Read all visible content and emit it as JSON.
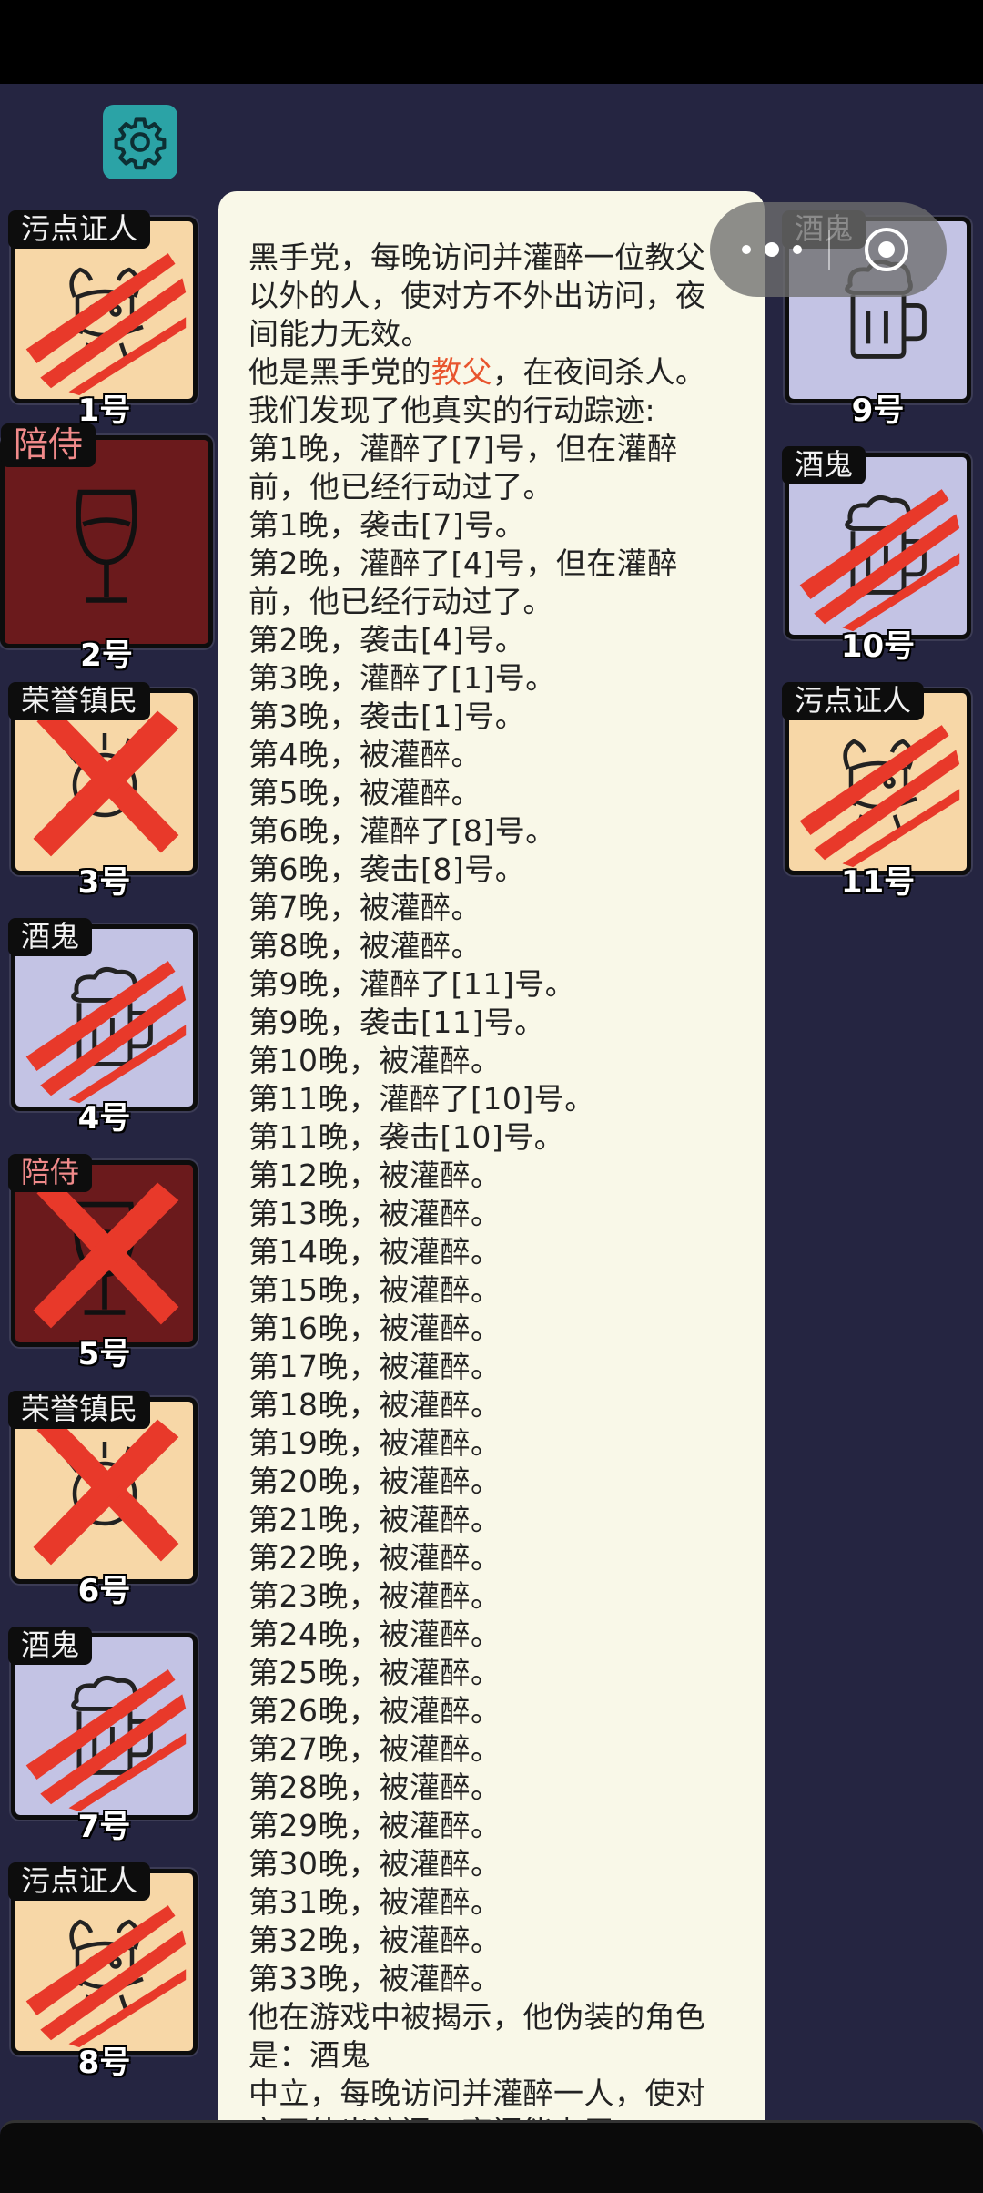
{
  "players": [
    {
      "role": "污点证人",
      "number": "1号",
      "theme": "witness",
      "mark": "claw"
    },
    {
      "role": "陪侍",
      "number": "2号",
      "theme": "servant",
      "mark": "none"
    },
    {
      "role": "荣誉镇民",
      "number": "3号",
      "theme": "citizen",
      "mark": "cross"
    },
    {
      "role": "酒鬼",
      "number": "4号",
      "theme": "drunk",
      "mark": "claw"
    },
    {
      "role": "陪侍",
      "number": "5号",
      "theme": "servant",
      "mark": "cross"
    },
    {
      "role": "荣誉镇民",
      "number": "6号",
      "theme": "citizen",
      "mark": "cross"
    },
    {
      "role": "酒鬼",
      "number": "7号",
      "theme": "drunk",
      "mark": "claw"
    },
    {
      "role": "污点证人",
      "number": "8号",
      "theme": "witness",
      "mark": "claw"
    },
    {
      "role": "酒鬼",
      "number": "9号",
      "theme": "drunk",
      "mark": "none"
    },
    {
      "role": "酒鬼",
      "number": "10号",
      "theme": "drunk",
      "mark": "claw"
    },
    {
      "role": "污点证人",
      "number": "11号",
      "theme": "witness",
      "mark": "claw"
    }
  ],
  "log": {
    "intro": "黑手党，每晚访问并灌醉一位教父以外的人，使对方不外出访问，夜间能力无效。",
    "identity_prefix": "他是黑手党的",
    "identity_highlight": "教父",
    "identity_suffix": "，在夜间杀人。",
    "trace_header": "我们发现了他真实的行动踪迹:",
    "entries": [
      "第1晚，灌醉了[7]号，但在灌醉前，他已经行动过了。",
      "第1晚，袭击[7]号。",
      "第2晚，灌醉了[4]号，但在灌醉前，他已经行动过了。",
      "第2晚，袭击[4]号。",
      "第3晚，灌醉了[1]号。",
      "第3晚，袭击[1]号。",
      "第4晚，被灌醉。",
      "第5晚，被灌醉。",
      "第6晚，灌醉了[8]号。",
      "第6晚，袭击[8]号。",
      "第7晚，被灌醉。",
      "第8晚，被灌醉。",
      "第9晚，灌醉了[11]号。",
      "第9晚，袭击[11]号。",
      "第10晚，被灌醉。",
      "第11晚，灌醉了[10]号。",
      "第11晚，袭击[10]号。",
      "第12晚，被灌醉。",
      "第13晚，被灌醉。",
      "第14晚，被灌醉。",
      "第15晚，被灌醉。",
      "第16晚，被灌醉。",
      "第17晚，被灌醉。",
      "第18晚，被灌醉。",
      "第19晚，被灌醉。",
      "第20晚，被灌醉。",
      "第21晚，被灌醉。",
      "第22晚，被灌醉。",
      "第23晚，被灌醉。",
      "第24晚，被灌醉。",
      "第25晚，被灌醉。",
      "第26晚，被灌醉。",
      "第27晚，被灌醉。",
      "第28晚，被灌醉。",
      "第29晚，被灌醉。",
      "第30晚，被灌醉。",
      "第31晚，被灌醉。",
      "第32晚，被灌醉。",
      "第33晚，被灌醉。"
    ],
    "reveal": "他在游戏中被揭示，他伪装的角色是：酒鬼",
    "disguise_desc": "中立，每晚访问并灌醉一人，使对方不外出访问，夜间能力无"
  },
  "colors": {
    "highlight": "#e8552e",
    "panel": "#f9f8e8",
    "background": "#252541"
  }
}
